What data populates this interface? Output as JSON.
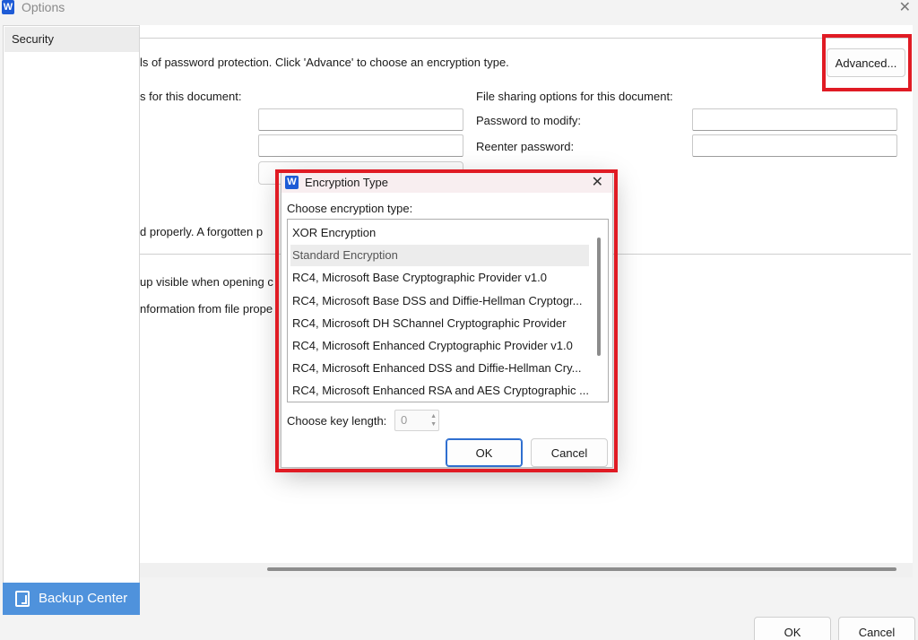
{
  "window": {
    "title": "Options",
    "app_icon": "W"
  },
  "sidebar": {
    "items": [
      {
        "label": "Security"
      }
    ],
    "backup_label": "Backup Center"
  },
  "main": {
    "intro_text": "ls of password protection. Click 'Advance' to choose an encryption type.",
    "advanced_label": "Advanced...",
    "open_section": "s for this document:",
    "share_section": "File sharing options for this document:",
    "modify_label": "Password to modify:",
    "reenter_label": "Reenter password:",
    "warning_text": "d properly. A forgotten p",
    "privacy_line1": "up visible when opening c",
    "privacy_line2": "nformation from file prope"
  },
  "footer": {
    "ok_label": "OK",
    "cancel_label": "Cancel"
  },
  "dialog": {
    "title": "Encryption Type",
    "app_icon": "W",
    "choose_label": "Choose encryption type:",
    "items": [
      "XOR Encryption",
      "Standard Encryption",
      "RC4, Microsoft Base Cryptographic Provider v1.0",
      "RC4, Microsoft Base DSS and Diffie-Hellman Cryptogr...",
      "RC4, Microsoft DH SChannel Cryptographic Provider",
      "RC4, Microsoft Enhanced Cryptographic Provider v1.0",
      "RC4, Microsoft Enhanced DSS and Diffie-Hellman Cry...",
      "RC4, Microsoft Enhanced RSA and AES Cryptographic ..."
    ],
    "selected_index": 1,
    "key_length_label": "Choose key length:",
    "key_length_value": "0",
    "ok_label": "OK",
    "cancel_label": "Cancel"
  },
  "colors": {
    "highlight_red": "#e01b24",
    "accent_blue": "#4f92dc",
    "ok_border": "#2f6fd0"
  }
}
